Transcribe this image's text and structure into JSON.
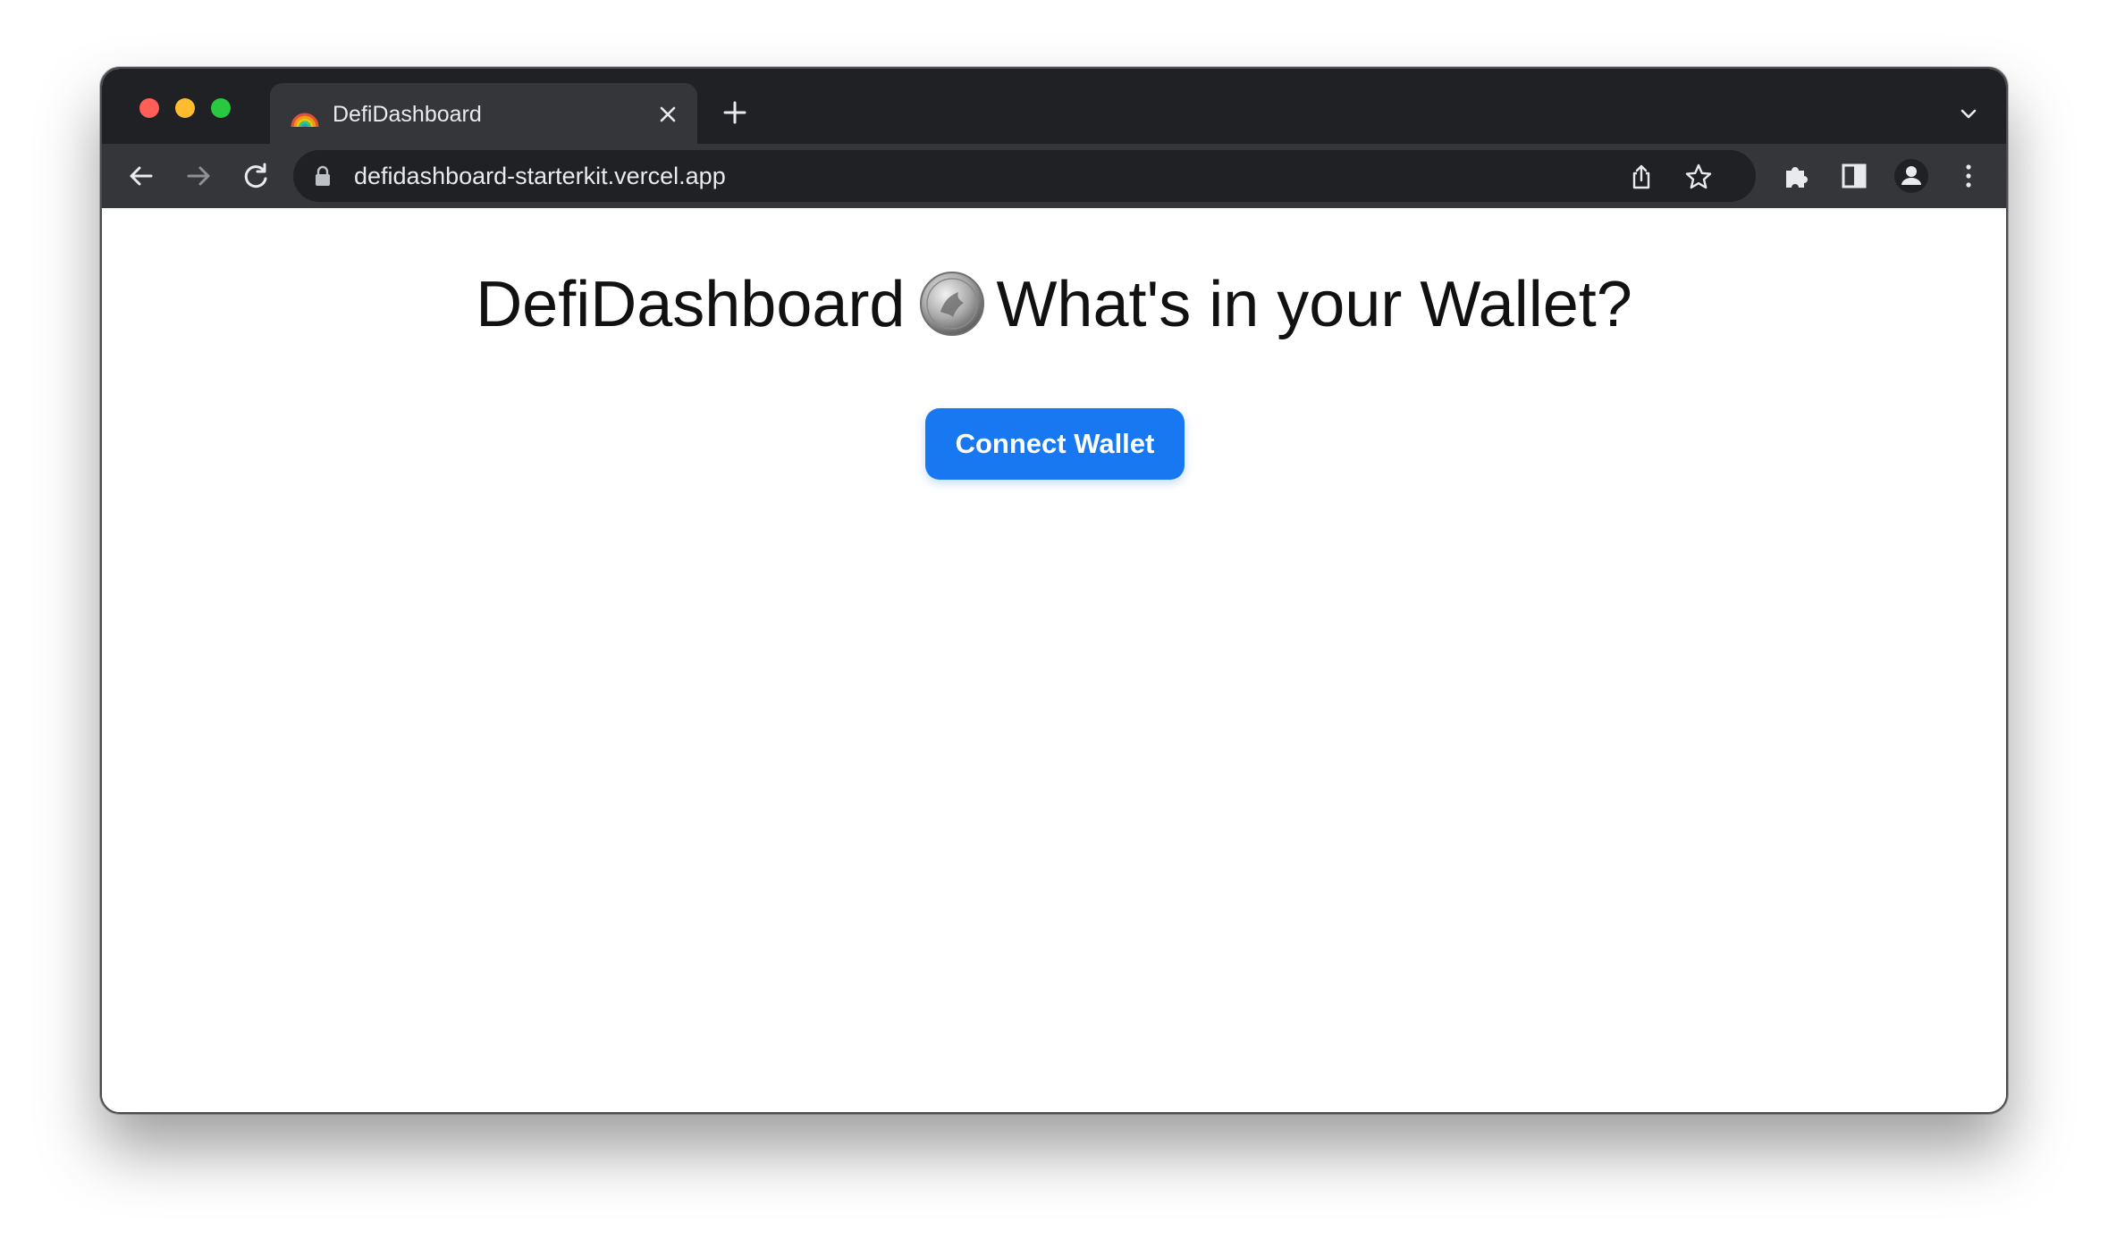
{
  "browser": {
    "tab": {
      "title": "DefiDashboard",
      "favicon": "rainbow-icon"
    },
    "address_bar": {
      "url": "defidashboard-starterkit.vercel.app"
    },
    "icons": {
      "back": "arrow-left-icon",
      "forward": "arrow-right-icon",
      "reload": "reload-icon",
      "lock": "lock-icon",
      "share": "share-icon",
      "bookmark": "star-icon",
      "extensions": "puzzle-icon",
      "side_panel": "side-panel-icon",
      "profile": "profile-icon",
      "menu": "kebab-menu-icon",
      "new_tab": "plus-icon",
      "tab_search": "chevron-down-icon"
    },
    "colors": {
      "tabstrip": "#202124",
      "toolbar": "#35363a",
      "close": "#ff5f57",
      "minimize": "#febc2e",
      "maximize": "#28c840"
    }
  },
  "page": {
    "headline_left": "DefiDashboard",
    "headline_icon": "coin-icon",
    "headline_right": "What's in your Wallet?",
    "connect_button": "Connect Wallet",
    "accent_color": "#1778f2"
  }
}
